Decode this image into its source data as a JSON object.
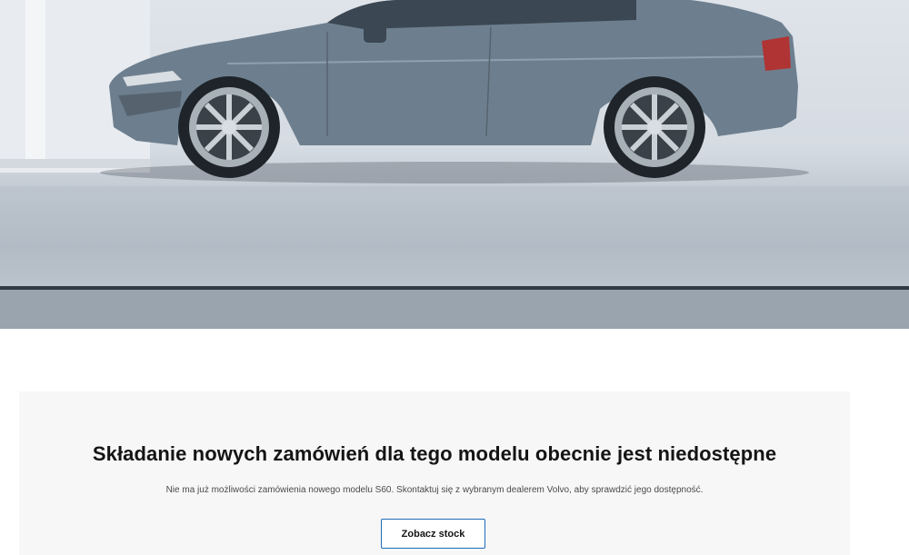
{
  "hero": {
    "image": "volvo-s60-side-view"
  },
  "notice": {
    "title": "Składanie nowych zamówień dla tego modelu obecnie jest niedostępne",
    "description": "Nie ma już możliwości zamówienia nowego modelu S60. Skontaktuj się z wybranym dealerem Volvo, aby sprawdzić jego dostępność.",
    "button_label": "Zobacz stock"
  },
  "colors": {
    "background": "#ffffff",
    "notice_background": "#f7f7f7",
    "button_border": "#1c6bba",
    "car_body": "#6d7f8f",
    "title_text": "#141414"
  }
}
